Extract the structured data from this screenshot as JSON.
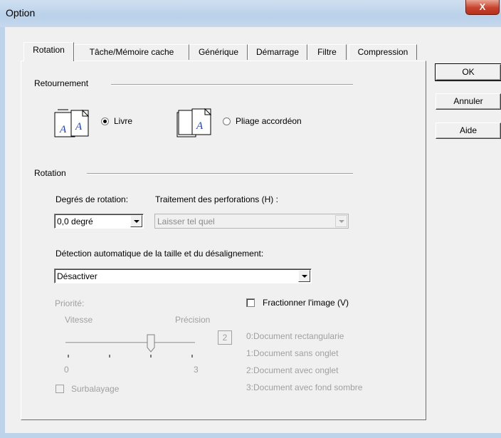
{
  "window": {
    "title": "Option",
    "close_glyph": "X"
  },
  "tabs": [
    {
      "label": "Rotation",
      "active": true
    },
    {
      "label": "Tâche/Mémoire cache"
    },
    {
      "label": "Générique"
    },
    {
      "label": "Démarrage"
    },
    {
      "label": "Filtre"
    },
    {
      "label": "Compression"
    }
  ],
  "buttons": {
    "ok": "OK",
    "cancel": "Annuler",
    "help": "Aide"
  },
  "retournement": {
    "title": "Retournement",
    "option_book": "Livre",
    "option_accordion": "Pliage accordéon",
    "selected": "book",
    "icon_letter": "A"
  },
  "rotation": {
    "title": "Rotation",
    "degrees_label": "Degrés de rotation:",
    "degrees_value": "0,0 degré",
    "punch_label": "Traitement des perforations (H) :",
    "punch_value": "Laisser tel quel",
    "auto_detect_label": "Détection automatique de la taille et du désalignement:",
    "auto_detect_value": "Désactiver"
  },
  "priority": {
    "label": "Priorité:",
    "speed": "Vitesse",
    "precision": "Précision",
    "value": "2",
    "tick_min": "0",
    "tick_max": "3",
    "slider_level": 2
  },
  "split_image_label": "Fractionner l'image (V)",
  "overscan_label": "Surbalayage",
  "legend": [
    "0:Document rectangularie",
    "1:Document sans onglet",
    "2:Document avec onglet",
    "3:Document avec fond sombre"
  ],
  "colors": {
    "title_bar": "#b9d1ea",
    "close_button": "#c7432d",
    "icon_letter": "#1f3fbf"
  }
}
